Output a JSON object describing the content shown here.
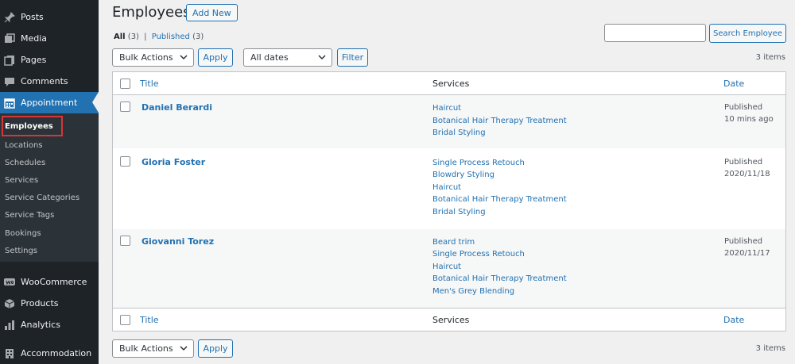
{
  "sidebar": {
    "items": [
      {
        "label": "Posts",
        "icon": "pin-icon"
      },
      {
        "label": "Media",
        "icon": "media-icon"
      },
      {
        "label": "Pages",
        "icon": "pages-icon"
      },
      {
        "label": "Comments",
        "icon": "comment-icon"
      },
      {
        "label": "Appointment",
        "icon": "calendar-icon"
      }
    ],
    "submenu": [
      "Employees",
      "Locations",
      "Schedules",
      "Services",
      "Service Categories",
      "Service Tags",
      "Bookings",
      "Settings"
    ],
    "bottom_items": [
      {
        "label": "WooCommerce",
        "icon": "woocommerce-icon"
      },
      {
        "label": "Products",
        "icon": "products-icon"
      },
      {
        "label": "Analytics",
        "icon": "analytics-icon"
      },
      {
        "label": "Accommodation",
        "icon": "building-icon"
      }
    ]
  },
  "header": {
    "title": "Employees",
    "add_new": "Add New"
  },
  "filters": {
    "all_label": "All",
    "all_count": "(3)",
    "separator": "|",
    "published_label": "Published",
    "published_count": "(3)",
    "search_button": "Search Employee",
    "bulk_actions": "Bulk Actions",
    "apply": "Apply",
    "dates": "All dates",
    "filter": "Filter",
    "count": "3 items"
  },
  "table": {
    "columns": {
      "title": "Title",
      "services": "Services",
      "date": "Date"
    },
    "rows": [
      {
        "name": "Daniel Berardi",
        "services": [
          "Haircut",
          "Botanical Hair Therapy Treatment",
          "Bridal Styling"
        ],
        "status": "Published",
        "date": "10 mins ago"
      },
      {
        "name": "Gloria Foster",
        "services": [
          "Single Process Retouch",
          "Blowdry Styling",
          "Haircut",
          "Botanical Hair Therapy Treatment",
          "Bridal Styling"
        ],
        "status": "Published",
        "date": "2020/11/18"
      },
      {
        "name": "Giovanni Torez",
        "services": [
          "Beard trim",
          "Single Process Retouch",
          "Haircut",
          "Botanical Hair Therapy Treatment",
          "Men's Grey Blending"
        ],
        "status": "Published",
        "date": "2020/11/17"
      }
    ]
  },
  "colors": {
    "accent": "#2271b1",
    "sidebar_bg": "#1d2327",
    "highlight": "#d63638"
  }
}
